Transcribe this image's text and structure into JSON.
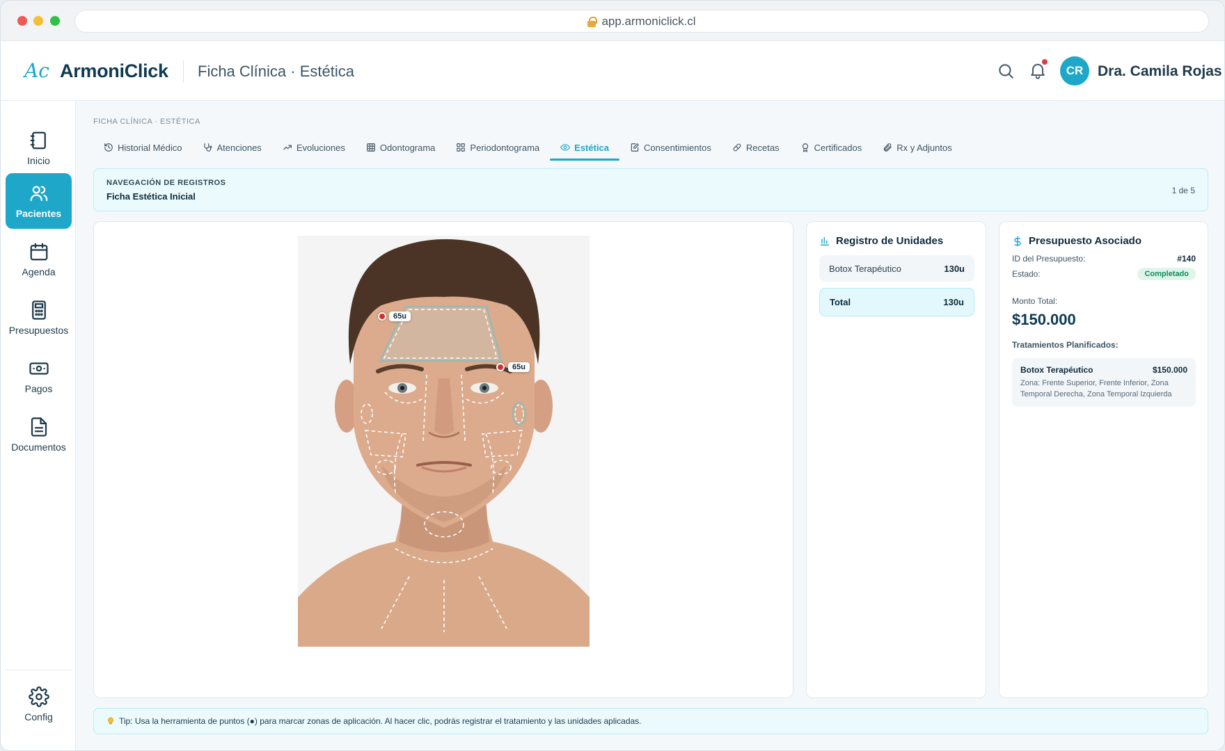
{
  "browser": {
    "url": "app.armoniclick.cl"
  },
  "header": {
    "logo_mark": "Ac",
    "brand": "ArmoniClick",
    "page_title": "Ficha Clínica · Estética",
    "user_initials": "CR",
    "user_name": "Dra. Camila Rojas"
  },
  "sidebar": {
    "items": [
      {
        "label": "Inicio",
        "icon": "notebook-icon"
      },
      {
        "label": "Pacientes",
        "icon": "users-icon",
        "active": true
      },
      {
        "label": "Agenda",
        "icon": "calendar-icon"
      },
      {
        "label": "Presupuestos",
        "icon": "calculator-icon"
      },
      {
        "label": "Pagos",
        "icon": "banknote-icon"
      },
      {
        "label": "Documentos",
        "icon": "document-icon"
      }
    ],
    "config_label": "Config"
  },
  "breadcrumb": "FICHA CLÍNICA · ESTÉTICA",
  "tabs": [
    {
      "label": "Historial Médico",
      "icon": "history-icon"
    },
    {
      "label": "Atenciones",
      "icon": "stethoscope-icon"
    },
    {
      "label": "Evoluciones",
      "icon": "trend-icon"
    },
    {
      "label": "Odontograma",
      "icon": "grid-icon"
    },
    {
      "label": "Periodontograma",
      "icon": "layout-icon"
    },
    {
      "label": "Estética",
      "icon": "eye-icon",
      "active": true
    },
    {
      "label": "Consentimientos",
      "icon": "edit-doc-icon"
    },
    {
      "label": "Recetas",
      "icon": "pill-icon"
    },
    {
      "label": "Certificados",
      "icon": "award-icon"
    },
    {
      "label": "Rx y Adjuntos",
      "icon": "paperclip-icon"
    }
  ],
  "record_nav": {
    "label": "NAVEGACIÓN DE REGISTROS",
    "value": "Ficha Estética Inicial",
    "page": "1 de 5"
  },
  "face": {
    "markers": [
      {
        "label": "65u"
      },
      {
        "label": "65u"
      }
    ]
  },
  "units": {
    "title": "Registro de Unidades",
    "rows": [
      {
        "name": "Botox Terapéutico",
        "units": "130u"
      }
    ],
    "total_label": "Total",
    "total_value": "130u"
  },
  "budget": {
    "title": "Presupuesto Asociado",
    "id_label": "ID del Presupuesto:",
    "id_value": "#140",
    "status_label": "Estado:",
    "status_value": "Completado",
    "amount_label": "Monto Total:",
    "amount_value": "$150.000",
    "planned_label": "Tratamientos Planificados:",
    "treatment": {
      "name": "Botox Terapéutico",
      "price": "$150.000",
      "zones": "Zona: Frente Superior, Frente Inferior, Zona Temporal Derecha, Zona Temporal Izquierda"
    }
  },
  "tip": "Tip: Usa la herramienta de puntos (●) para marcar zonas de aplicación. Al hacer clic, podrás registrar el tratamiento y las unidades aplicadas.",
  "colors": {
    "accent": "#1ea7c9",
    "brand": "#0e3a52",
    "success": "#0f8a5c",
    "marker": "#d32f2f"
  }
}
